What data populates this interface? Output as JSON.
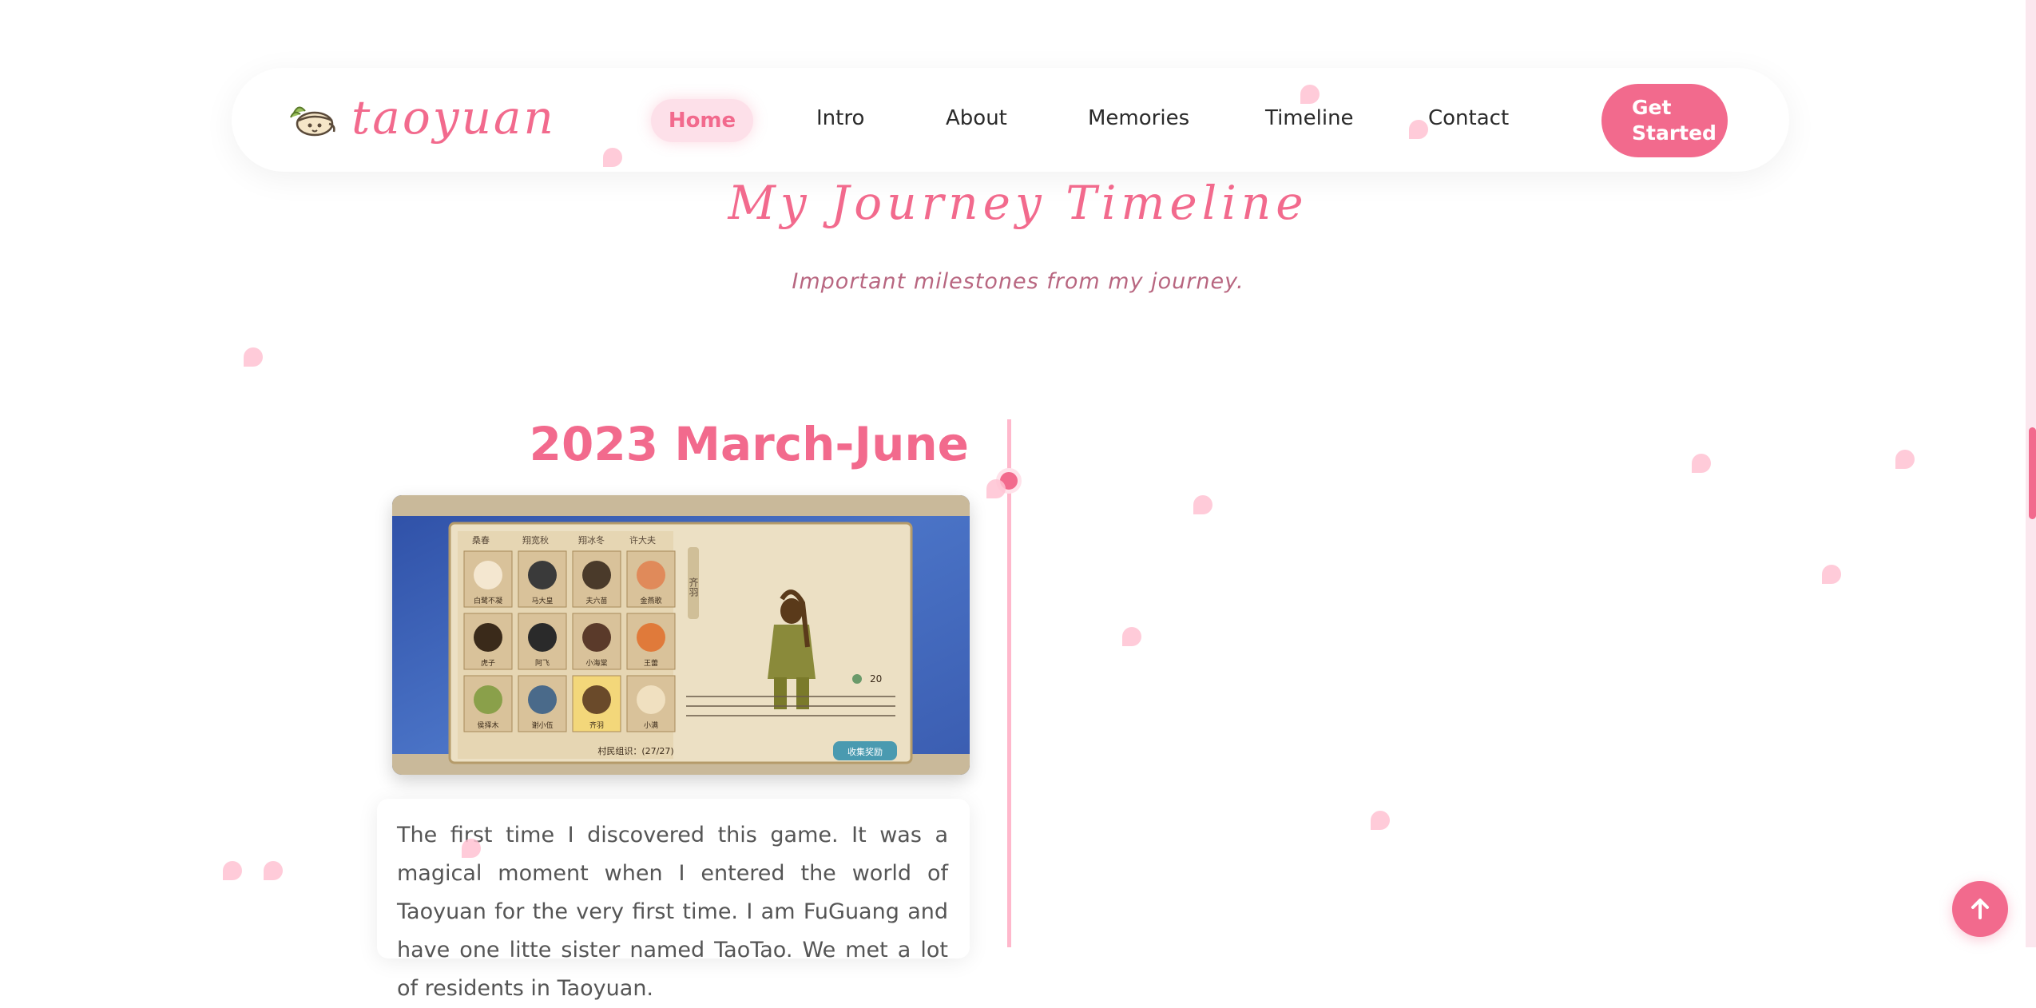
{
  "nav": {
    "logo_text": "taoyuan",
    "links": {
      "home": "Home",
      "intro": "Intro",
      "about": "About",
      "memories": "Memories",
      "timeline": "Timeline",
      "contact": "Contact"
    },
    "cta": "Get Started"
  },
  "hero": {
    "title": "My Journey Timeline",
    "subtitle": "Important milestones from my journey."
  },
  "timeline": {
    "entries": [
      {
        "date": "2023 March-June",
        "text": "The first time I discovered this game. It was a magical moment when I entered the world of Taoyuan for the very first time. I am FuGuang and have one litte sister named TaoTao. We met a lot of residents in Taoyuan.",
        "image": {
          "counter": "20",
          "footer_label": "村民组识：(27/27)",
          "button_label": "收集奖励",
          "side_label": "齐羽",
          "tabs": [
            "桑春",
            "翔宽秋",
            "翔冰冬",
            "许大夫"
          ],
          "names": [
            "白鹭不凝",
            "马大皇",
            "夫六苗",
            "金燕歌",
            "虎子",
            "阿飞",
            "小海棠",
            "王蕾",
            "侯择木",
            "谢小伍",
            "齐羽",
            "小满"
          ]
        }
      }
    ]
  },
  "colors": {
    "accent": "#f26a8d",
    "petal": "#ffc2d2",
    "timeline_line": "#ffb8cc"
  },
  "icons": {
    "logo": "cat-bowl-icon",
    "back_to_top": "arrow-up-icon"
  }
}
